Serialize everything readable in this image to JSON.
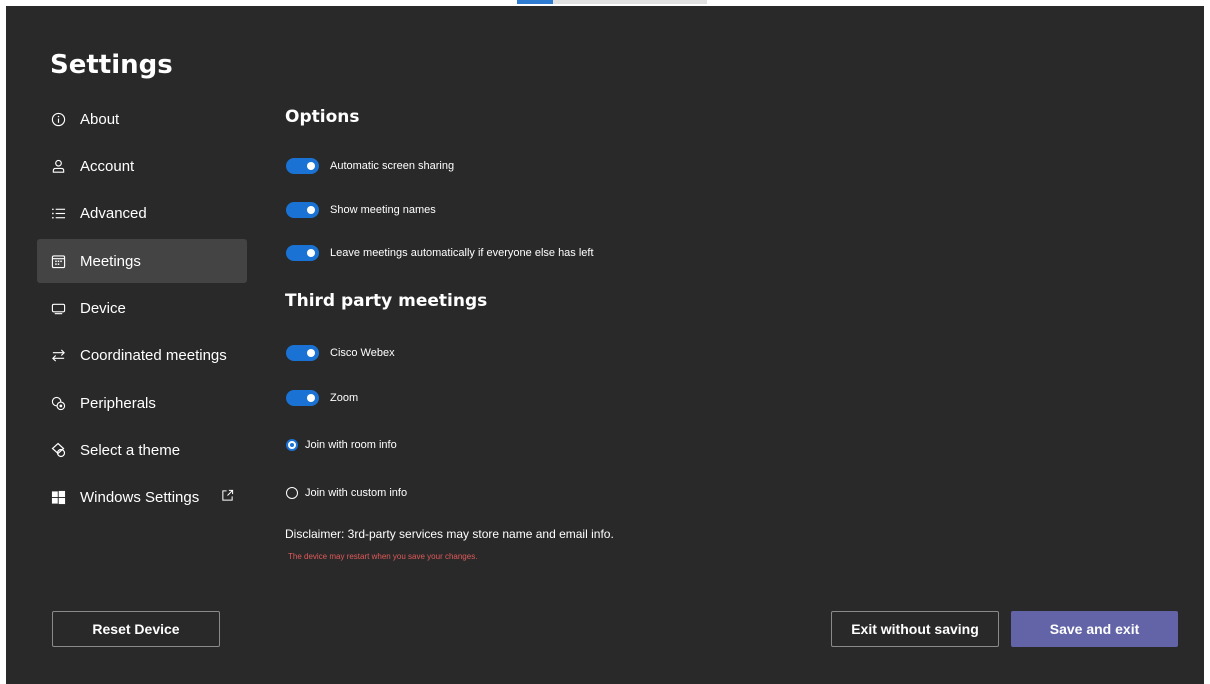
{
  "window": {
    "title": "Settings"
  },
  "sidebar": {
    "items": [
      {
        "label": "About",
        "icon": "info-icon",
        "selected": false
      },
      {
        "label": "Account",
        "icon": "person-icon",
        "selected": false
      },
      {
        "label": "Advanced",
        "icon": "list-icon",
        "selected": false
      },
      {
        "label": "Meetings",
        "icon": "calendar-icon",
        "selected": true
      },
      {
        "label": "Device",
        "icon": "monitor-icon",
        "selected": false
      },
      {
        "label": "Coordinated meetings",
        "icon": "arrows-swap-icon",
        "selected": false
      },
      {
        "label": "Peripherals",
        "icon": "peripherals-icon",
        "selected": false
      },
      {
        "label": "Select a theme",
        "icon": "shapes-icon",
        "selected": false
      },
      {
        "label": "Windows Settings",
        "icon": "windows-logo-icon",
        "selected": false,
        "external": "open-external-icon"
      }
    ]
  },
  "main": {
    "options": {
      "heading": "Options",
      "toggles": [
        {
          "label": "Automatic screen sharing",
          "on": true
        },
        {
          "label": "Show meeting names",
          "on": true
        },
        {
          "label": "Leave meetings automatically if everyone else has left",
          "on": true
        }
      ]
    },
    "third_party": {
      "heading": "Third party meetings",
      "toggles": [
        {
          "label": "Cisco Webex",
          "on": true
        },
        {
          "label": "Zoom",
          "on": true
        }
      ],
      "radios": [
        {
          "label": "Join with room info",
          "checked": true
        },
        {
          "label": "Join with custom info",
          "checked": false
        }
      ]
    },
    "disclaimer": "Disclaimer: 3rd-party services may store name and email info.",
    "warning": "The device may restart when you save your changes."
  },
  "footer": {
    "reset_label": "Reset Device",
    "exit_label": "Exit without saving",
    "save_label": "Save and exit"
  },
  "colors": {
    "background": "#292929",
    "selected_nav": "#444444",
    "toggle_on": "#1a73d4",
    "primary_button": "#6264a7",
    "warning_text": "#e05a5a"
  }
}
